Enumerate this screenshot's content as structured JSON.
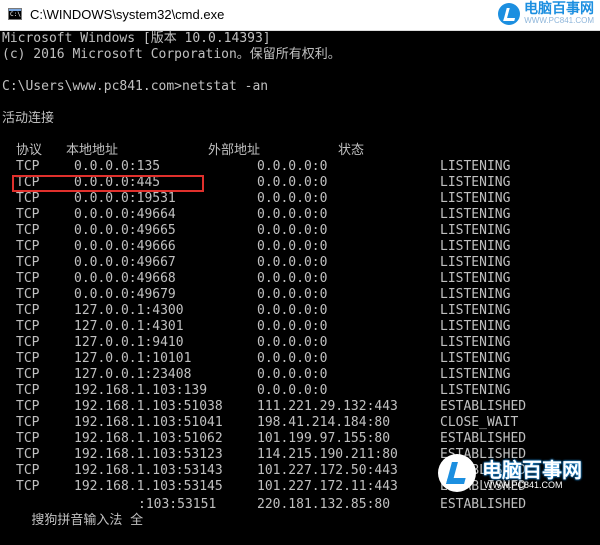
{
  "window": {
    "title": "C:\\WINDOWS\\system32\\cmd.exe",
    "icon": "cmd-icon"
  },
  "watermark": {
    "brand": "电脑百事网",
    "url": "WWW.PC841.COM",
    "brand_color": "#1c8fe0"
  },
  "console": {
    "lines": [
      "Microsoft Windows [版本 10.0.14393]",
      "(c) 2016 Microsoft Corporation。保留所有权利。",
      "",
      "C:\\Users\\www.pc841.com>netstat -an",
      "",
      "活动连接"
    ],
    "headers": {
      "protocol": "协议",
      "local": "本地地址",
      "foreign": "外部地址",
      "state": "状态"
    },
    "rows": [
      {
        "proto": "TCP",
        "local": "0.0.0.0:135",
        "foreign": "0.0.0.0:0",
        "state": "LISTENING"
      },
      {
        "proto": "TCP",
        "local": "0.0.0.0:445",
        "foreign": "0.0.0.0:0",
        "state": "LISTENING"
      },
      {
        "proto": "TCP",
        "local": "0.0.0.0:19531",
        "foreign": "0.0.0.0:0",
        "state": "LISTENING"
      },
      {
        "proto": "TCP",
        "local": "0.0.0.0:49664",
        "foreign": "0.0.0.0:0",
        "state": "LISTENING"
      },
      {
        "proto": "TCP",
        "local": "0.0.0.0:49665",
        "foreign": "0.0.0.0:0",
        "state": "LISTENING"
      },
      {
        "proto": "TCP",
        "local": "0.0.0.0:49666",
        "foreign": "0.0.0.0:0",
        "state": "LISTENING"
      },
      {
        "proto": "TCP",
        "local": "0.0.0.0:49667",
        "foreign": "0.0.0.0:0",
        "state": "LISTENING"
      },
      {
        "proto": "TCP",
        "local": "0.0.0.0:49668",
        "foreign": "0.0.0.0:0",
        "state": "LISTENING"
      },
      {
        "proto": "TCP",
        "local": "0.0.0.0:49679",
        "foreign": "0.0.0.0:0",
        "state": "LISTENING"
      },
      {
        "proto": "TCP",
        "local": "127.0.0.1:4300",
        "foreign": "0.0.0.0:0",
        "state": "LISTENING"
      },
      {
        "proto": "TCP",
        "local": "127.0.0.1:4301",
        "foreign": "0.0.0.0:0",
        "state": "LISTENING"
      },
      {
        "proto": "TCP",
        "local": "127.0.0.1:9410",
        "foreign": "0.0.0.0:0",
        "state": "LISTENING"
      },
      {
        "proto": "TCP",
        "local": "127.0.0.1:10101",
        "foreign": "0.0.0.0:0",
        "state": "LISTENING"
      },
      {
        "proto": "TCP",
        "local": "127.0.0.1:23408",
        "foreign": "0.0.0.0:0",
        "state": "LISTENING"
      },
      {
        "proto": "TCP",
        "local": "192.168.1.103:139",
        "foreign": "0.0.0.0:0",
        "state": "LISTENING"
      },
      {
        "proto": "TCP",
        "local": "192.168.1.103:51038",
        "foreign": "111.221.29.132:443",
        "state": "ESTABLISHED"
      },
      {
        "proto": "TCP",
        "local": "192.168.1.103:51041",
        "foreign": "198.41.214.184:80",
        "state": "CLOSE_WAIT"
      },
      {
        "proto": "TCP",
        "local": "192.168.1.103:51062",
        "foreign": "101.199.97.155:80",
        "state": "ESTABLISHED"
      },
      {
        "proto": "TCP",
        "local": "192.168.1.103:53123",
        "foreign": "114.215.190.211:80",
        "state": "ESTABLISHED"
      },
      {
        "proto": "TCP",
        "local": "192.168.1.103:53143",
        "foreign": "101.227.172.50:443",
        "state": "ESTABLISHED"
      },
      {
        "proto": "TCP",
        "local": "192.168.1.103:53145",
        "foreign": "101.227.172.11:443",
        "state": "ESTABLISHED"
      }
    ],
    "ime_line": {
      "ime_text": "搜狗拼音输入法 全 ",
      "local": ":103:53151",
      "foreign": "220.181.132.85:80",
      "state": "ESTABLISHED"
    },
    "highlight_color": "#e0302c"
  }
}
